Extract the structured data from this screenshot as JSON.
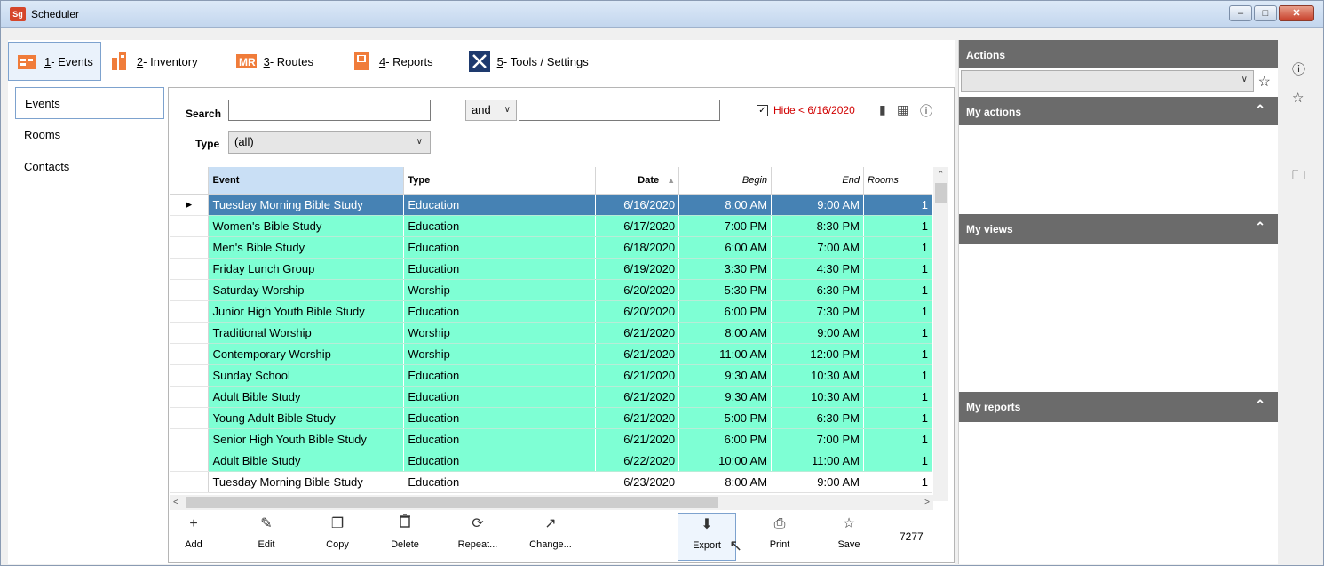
{
  "window": {
    "app_icon": "Sg",
    "title": "Scheduler",
    "buttons": {
      "minimize": "–",
      "maximize": "□",
      "close": "✕"
    }
  },
  "nav": {
    "tabs": [
      {
        "num": "1",
        "label": " - Events",
        "icon": "events-icon"
      },
      {
        "num": "2",
        "label": " - Inventory",
        "icon": "inventory-icon"
      },
      {
        "num": "3",
        "label": " - Routes",
        "icon": "routes-icon"
      },
      {
        "num": "4",
        "label": " - Reports",
        "icon": "reports-icon"
      },
      {
        "num": "5",
        "label": " - Tools / Settings",
        "icon": "tools-icon"
      }
    ]
  },
  "subnav": {
    "items": [
      "Events",
      "Rooms",
      "Contacts"
    ]
  },
  "filters": {
    "search_label": "Search",
    "search_value": "",
    "and_value": "and",
    "search2_value": "",
    "hide_label": "Hide < 6/16/2020",
    "hide_checked": "✓",
    "type_label": "Type",
    "type_value": "(all)"
  },
  "grid": {
    "columns": [
      "Event",
      "Type",
      "Date",
      "Begin",
      "End",
      "Rooms"
    ],
    "sort_indicator": "▲",
    "rows": [
      [
        "Tuesday Morning Bible Study",
        "Education",
        "6/16/2020",
        "8:00 AM",
        "9:00 AM",
        "1"
      ],
      [
        "Women's Bible Study",
        "Education",
        "6/17/2020",
        "7:00 PM",
        "8:30 PM",
        "1"
      ],
      [
        "Men's Bible Study",
        "Education",
        "6/18/2020",
        "6:00 AM",
        "7:00 AM",
        "1"
      ],
      [
        "Friday Lunch Group",
        "Education",
        "6/19/2020",
        "3:30 PM",
        "4:30 PM",
        "1"
      ],
      [
        "Saturday Worship",
        "Worship",
        "6/20/2020",
        "5:30 PM",
        "6:30 PM",
        "1"
      ],
      [
        "Junior High Youth Bible Study",
        "Education",
        "6/20/2020",
        "6:00 PM",
        "7:30 PM",
        "1"
      ],
      [
        "Traditional Worship",
        "Worship",
        "6/21/2020",
        "8:00 AM",
        "9:00 AM",
        "1"
      ],
      [
        "Contemporary Worship",
        "Worship",
        "6/21/2020",
        "11:00 AM",
        "12:00 PM",
        "1"
      ],
      [
        "Sunday School",
        "Education",
        "6/21/2020",
        "9:30 AM",
        "10:30 AM",
        "1"
      ],
      [
        "Adult Bible Study",
        "Education",
        "6/21/2020",
        "9:30 AM",
        "10:30 AM",
        "1"
      ],
      [
        "Young Adult Bible Study",
        "Education",
        "6/21/2020",
        "5:00 PM",
        "6:30 PM",
        "1"
      ],
      [
        "Senior High Youth Bible Study",
        "Education",
        "6/21/2020",
        "6:00 PM",
        "7:00 PM",
        "1"
      ],
      [
        "Adult Bible Study",
        "Education",
        "6/22/2020",
        "10:00 AM",
        "11:00 AM",
        "1"
      ],
      [
        "Tuesday Morning Bible Study",
        "Education",
        "6/23/2020",
        "8:00 AM",
        "9:00 AM",
        "1"
      ]
    ],
    "colors": {
      "row_bg": "#7effd4",
      "selected_bg": "#4682b4"
    }
  },
  "toolbar": {
    "buttons": [
      {
        "label": "Add",
        "icon": "plus-icon",
        "glyph": "+"
      },
      {
        "label": "Edit",
        "icon": "pencil-icon",
        "glyph": "✎"
      },
      {
        "label": "Copy",
        "icon": "copy-icon",
        "glyph": "❐"
      },
      {
        "label": "Delete",
        "icon": "trash-icon",
        "glyph": "🗑"
      },
      {
        "label": "Repeat...",
        "icon": "repeat-icon",
        "glyph": "⟳"
      },
      {
        "label": "Change...",
        "icon": "change-icon",
        "glyph": "↗"
      },
      {
        "label": "Export",
        "icon": "export-icon",
        "glyph": "⬇"
      },
      {
        "label": "Print",
        "icon": "print-icon",
        "glyph": "⎙"
      },
      {
        "label": "Save",
        "icon": "save-star-icon",
        "glyph": "☆"
      }
    ],
    "count": "7277"
  },
  "right_panel": {
    "actions_title": "Actions",
    "actions_value": "",
    "sections": [
      "My actions",
      "My views",
      "My reports"
    ]
  }
}
